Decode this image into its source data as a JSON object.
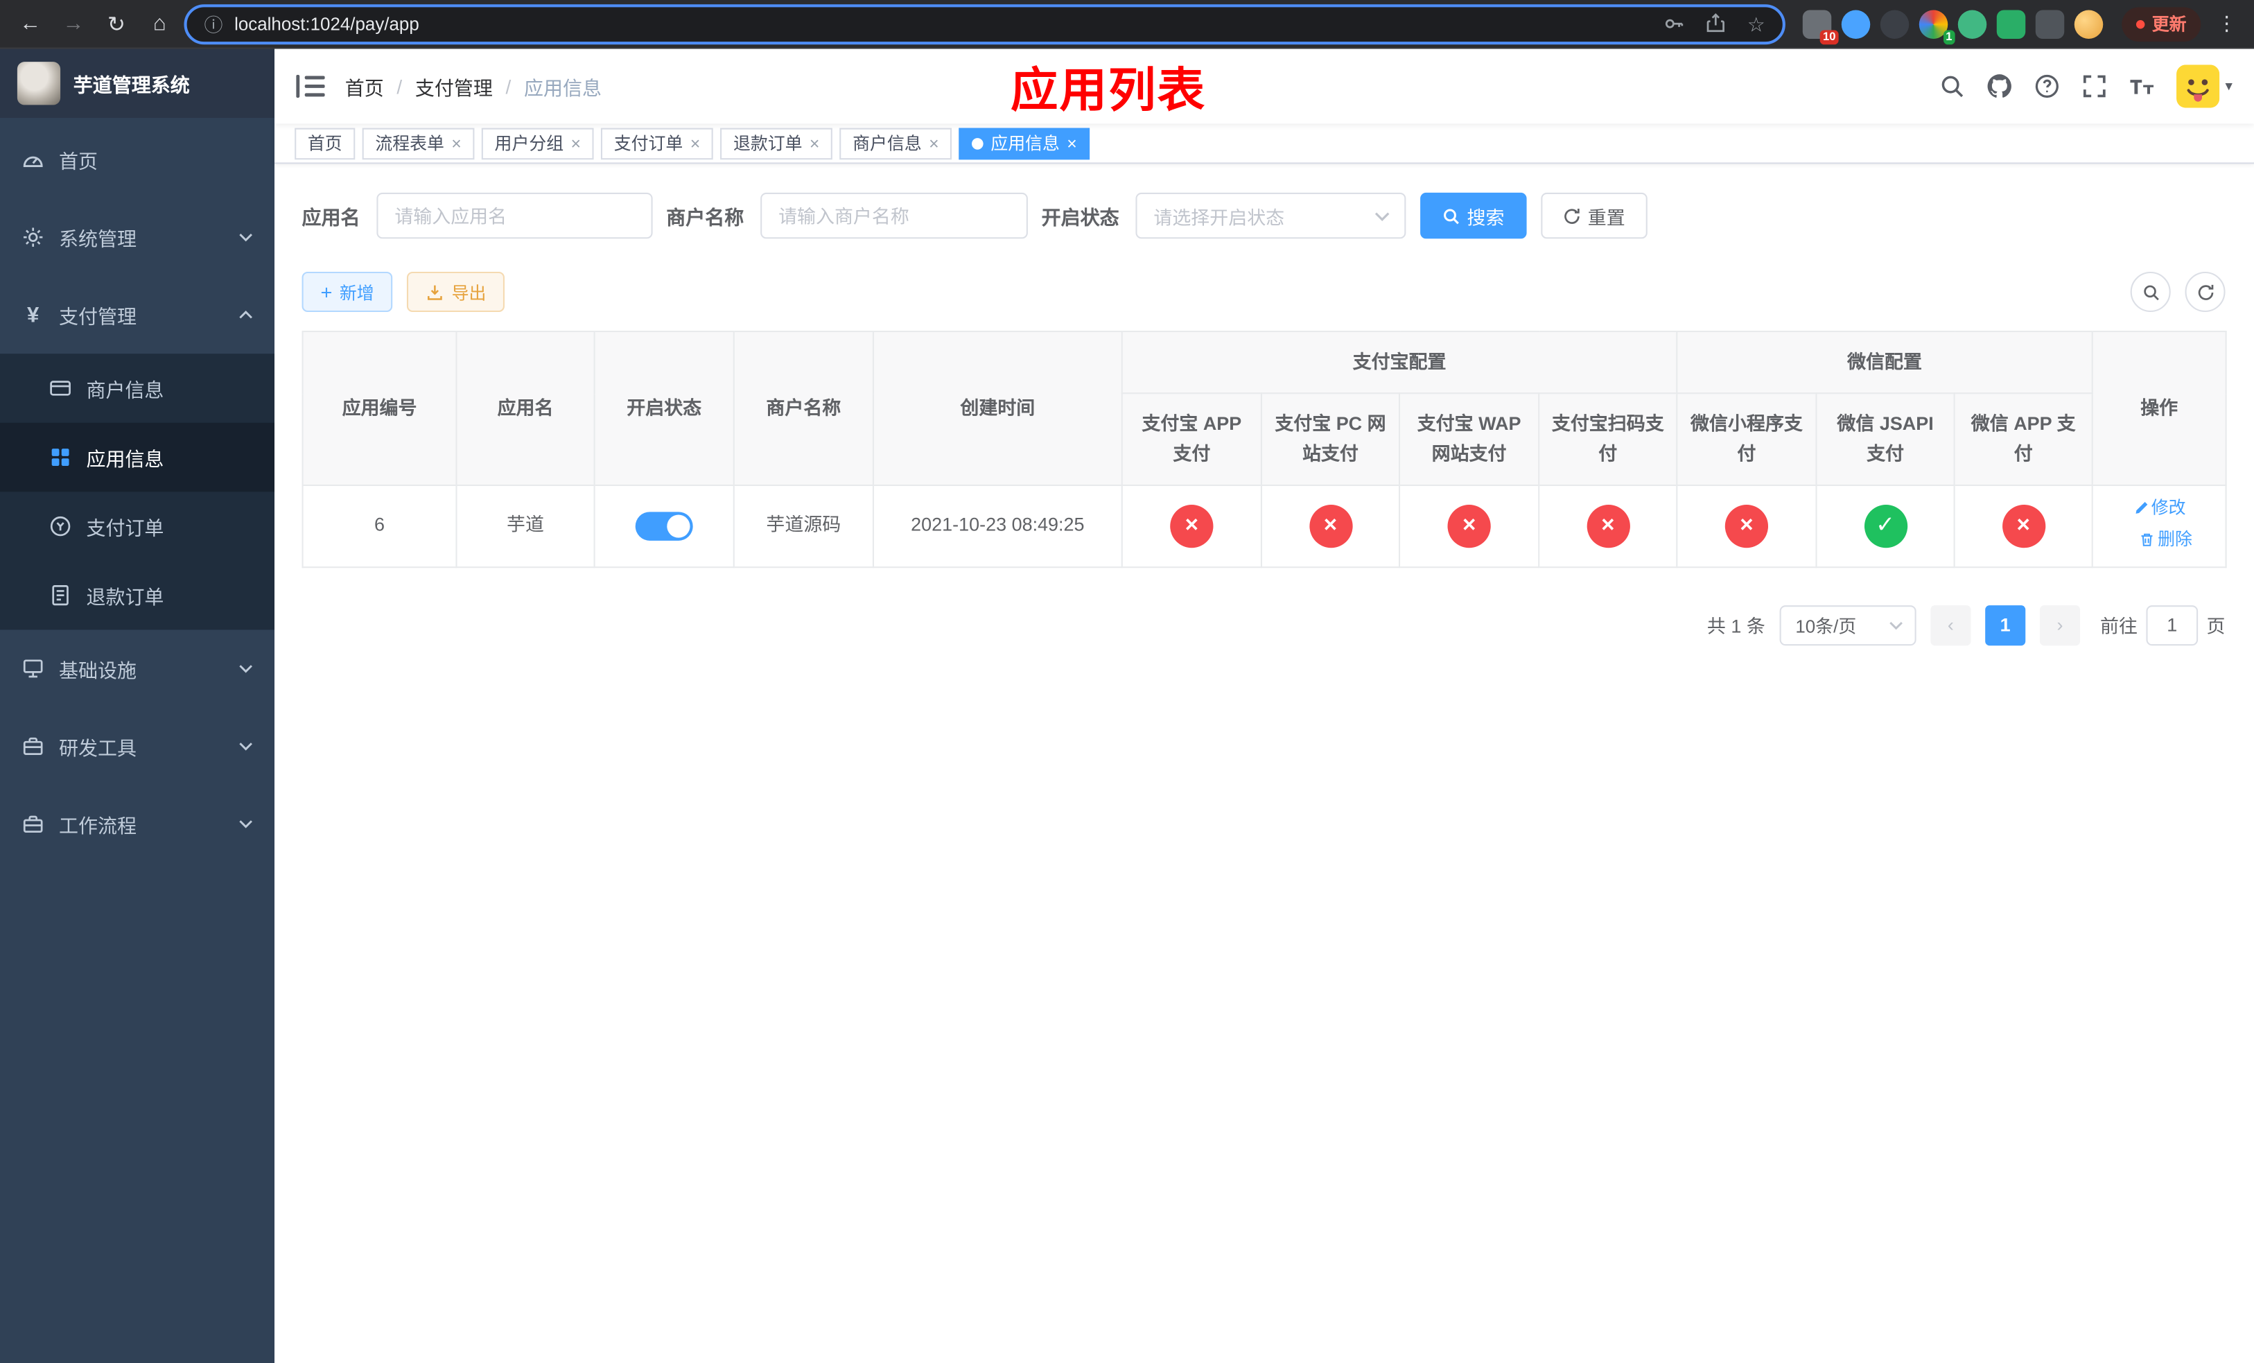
{
  "browser": {
    "url": "localhost:1024/pay/app",
    "update_label": "更新",
    "extension_badge_first": "10",
    "extension_badge_fourth": "1"
  },
  "sidebar": {
    "title": "芋道管理系统",
    "menu": [
      {
        "label": "首页"
      },
      {
        "label": "系统管理"
      },
      {
        "label": "支付管理"
      },
      {
        "label": "商户信息"
      },
      {
        "label": "应用信息"
      },
      {
        "label": "支付订单"
      },
      {
        "label": "退款订单"
      },
      {
        "label": "基础设施"
      },
      {
        "label": "研发工具"
      },
      {
        "label": "工作流程"
      }
    ]
  },
  "header": {
    "breadcrumb": [
      "首页",
      "支付管理",
      "应用信息"
    ],
    "annotation": "应用列表"
  },
  "tabs": [
    {
      "label": "首页"
    },
    {
      "label": "流程表单"
    },
    {
      "label": "用户分组"
    },
    {
      "label": "支付订单"
    },
    {
      "label": "退款订单"
    },
    {
      "label": "商户信息"
    },
    {
      "label": "应用信息"
    }
  ],
  "filters": {
    "app_name_label": "应用名",
    "app_name_placeholder": "请输入应用名",
    "merchant_label": "商户名称",
    "merchant_placeholder": "请输入商户名称",
    "status_label": "开启状态",
    "status_placeholder": "请选择开启状态",
    "search_label": "搜索",
    "reset_label": "重置"
  },
  "toolbar": {
    "add_label": "新增",
    "export_label": "导出"
  },
  "table": {
    "headers": {
      "app_id": "应用编号",
      "app_name": "应用名",
      "status": "开启状态",
      "merchant_name": "商户名称",
      "create_time": "创建时间",
      "alipay_group": "支付宝配置",
      "wechat_group": "微信配置",
      "actions": "操作",
      "alipay_cols": [
        "支付宝 APP 支付",
        "支付宝 PC 网站支付",
        "支付宝 WAP 网站支付",
        "支付宝扫码支付"
      ],
      "wechat_cols": [
        "微信小程序支付",
        "微信 JSAPI 支付",
        "微信 APP 支付"
      ]
    },
    "rows": [
      {
        "app_id": "6",
        "app_name": "芋道",
        "enabled": true,
        "merchant_name": "芋道源码",
        "create_time": "2021-10-23 08:49:25",
        "alipay": [
          false,
          false,
          false,
          false
        ],
        "wechat": [
          false,
          true,
          false
        ],
        "edit_label": "修改",
        "delete_label": "删除"
      }
    ]
  },
  "pagination": {
    "total_text": "共 1 条",
    "page_size_label": "10条/页",
    "current_page": "1",
    "goto_label": "前往",
    "goto_value": "1",
    "goto_unit": "页"
  },
  "colors": {
    "primary": "#409eff",
    "success": "#1fc15f",
    "danger": "#f5494d",
    "sidebar_bg": "#304156",
    "submenu_bg": "#1f2d3d",
    "annotation_red": "#ff0000"
  }
}
